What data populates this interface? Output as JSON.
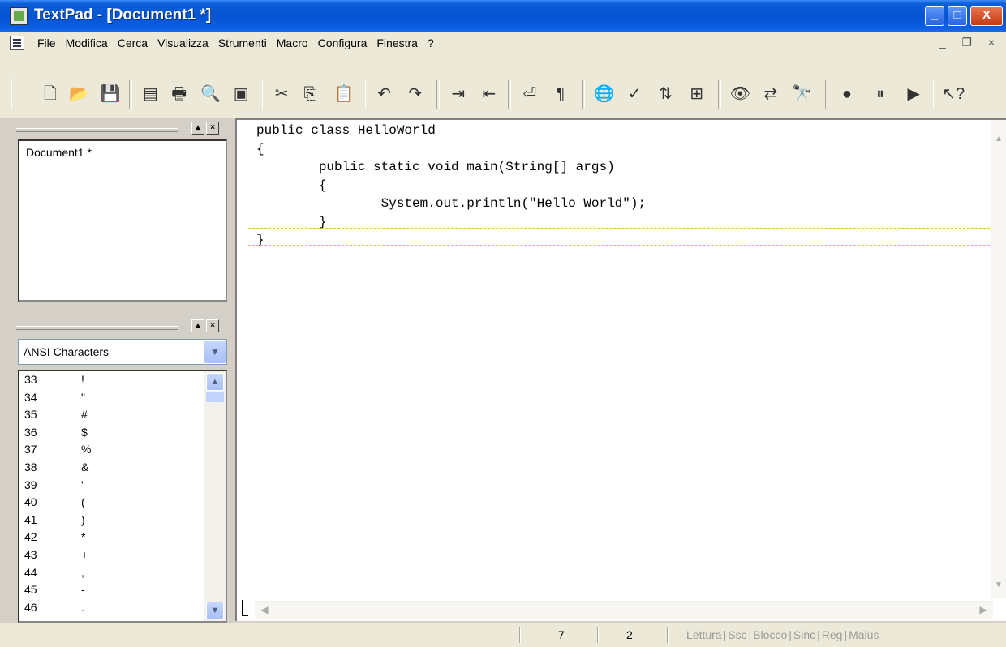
{
  "window": {
    "title": "TextPad - [Document1 *]",
    "controls": {
      "minimize": "_",
      "maximize": "□",
      "close": "X"
    }
  },
  "menu": {
    "items": [
      "File",
      "Modifica",
      "Cerca",
      "Visualizza",
      "Strumenti",
      "Macro",
      "Configura",
      "Finestra",
      "?"
    ],
    "mdi_controls": "_ ❐ ×"
  },
  "toolbar": {
    "buttons": [
      {
        "name": "new-file-icon",
        "glyph": "🗋"
      },
      {
        "name": "open-folder-icon",
        "glyph": "📂"
      },
      {
        "name": "save-icon",
        "glyph": "💾"
      },
      {
        "name": "workspace-icon",
        "glyph": "▤"
      },
      {
        "name": "print-icon",
        "glyph": "🖶"
      },
      {
        "name": "print-preview-icon",
        "glyph": "🔍"
      },
      {
        "name": "properties-icon",
        "glyph": "▣"
      },
      {
        "name": "cut-icon",
        "glyph": "✂"
      },
      {
        "name": "copy-icon",
        "glyph": "⎘"
      },
      {
        "name": "paste-icon",
        "glyph": "📋"
      },
      {
        "name": "undo-icon",
        "glyph": "↶"
      },
      {
        "name": "redo-icon",
        "glyph": "↷"
      },
      {
        "name": "indent-icon",
        "glyph": "⇥"
      },
      {
        "name": "outdent-icon",
        "glyph": "⇤"
      },
      {
        "name": "word-wrap-icon",
        "glyph": "⏎"
      },
      {
        "name": "show-whitespace-icon",
        "glyph": "¶"
      },
      {
        "name": "web-icon",
        "glyph": "🌐"
      },
      {
        "name": "spell-check-icon",
        "glyph": "✓"
      },
      {
        "name": "sort-icon",
        "glyph": "⇅"
      },
      {
        "name": "compare-icon",
        "glyph": "⊞"
      },
      {
        "name": "find-icon",
        "glyph": "👁"
      },
      {
        "name": "replace-icon",
        "glyph": "⇄"
      },
      {
        "name": "find-in-files-icon",
        "glyph": "🔭"
      },
      {
        "name": "record-macro-icon",
        "glyph": "●"
      },
      {
        "name": "pause-macro-icon",
        "glyph": "⏸"
      },
      {
        "name": "play-macro-icon",
        "glyph": "▶"
      },
      {
        "name": "context-help-icon",
        "glyph": "↖?"
      }
    ]
  },
  "document_selector": {
    "documents": [
      "Document1 *"
    ]
  },
  "clip_library": {
    "selected": "ANSI Characters",
    "rows": [
      {
        "num": "33",
        "ch": "!"
      },
      {
        "num": "34",
        "ch": "\""
      },
      {
        "num": "35",
        "ch": "#"
      },
      {
        "num": "36",
        "ch": "$"
      },
      {
        "num": "37",
        "ch": "%"
      },
      {
        "num": "38",
        "ch": "&"
      },
      {
        "num": "39",
        "ch": "'"
      },
      {
        "num": "40",
        "ch": "("
      },
      {
        "num": "41",
        "ch": ")"
      },
      {
        "num": "42",
        "ch": "*"
      },
      {
        "num": "43",
        "ch": "+"
      },
      {
        "num": "44",
        "ch": ","
      },
      {
        "num": "45",
        "ch": "-"
      },
      {
        "num": "46",
        "ch": "."
      }
    ]
  },
  "editor": {
    "lines": [
      "public class HelloWorld",
      "{",
      "        public static void main(String[] args)",
      "        {",
      "                System.out.println(\"Hello World\");",
      "        }",
      "}"
    ]
  },
  "status": {
    "line": "7",
    "column": "2",
    "flags": [
      "Lettura",
      "Ssc",
      "Blocco",
      "Sinc",
      "Reg",
      "Maius"
    ]
  }
}
